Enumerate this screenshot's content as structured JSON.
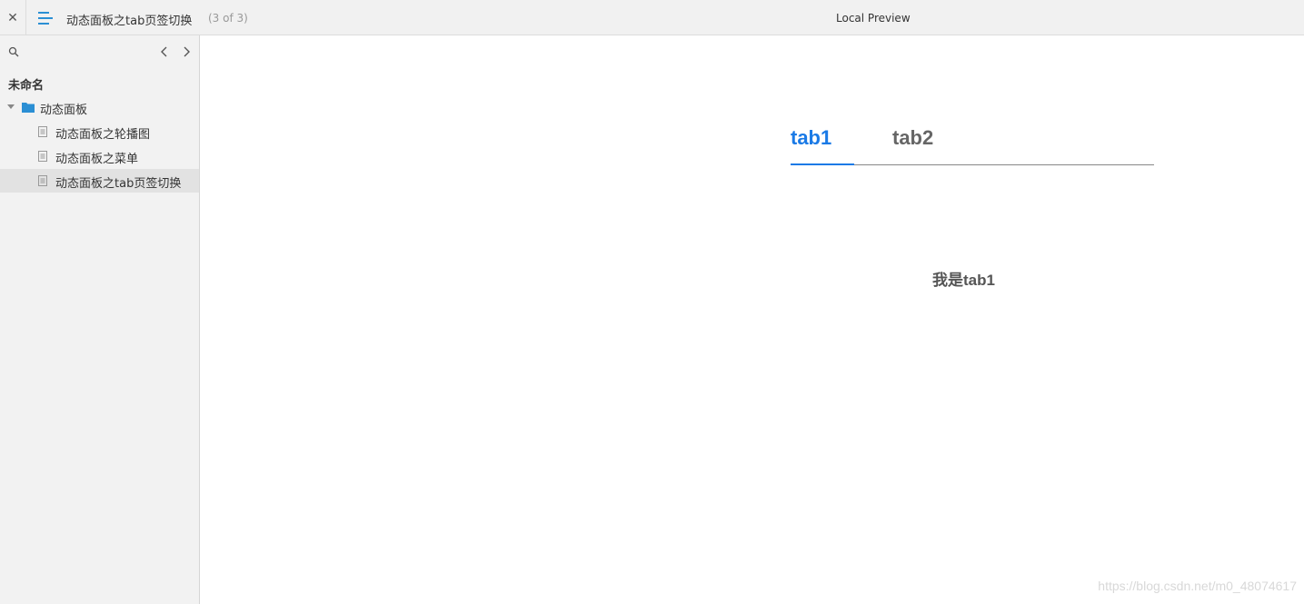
{
  "topbar": {
    "close_icon": "close-icon",
    "menu_icon": "menu-lines-icon",
    "doc_title": "动态面板之tab页签切换",
    "doc_count": "(3 of 3)",
    "preview_title": "Local Preview"
  },
  "sidebar": {
    "project_name": "未命名",
    "folder": {
      "label": "动态面板"
    },
    "pages": [
      {
        "label": "动态面板之轮播图"
      },
      {
        "label": "动态面板之菜单"
      },
      {
        "label": "动态面板之tab页签切换",
        "active": true
      }
    ]
  },
  "content": {
    "tabs": [
      {
        "label": "tab1",
        "active": true
      },
      {
        "label": "tab2",
        "active": false
      }
    ],
    "panel_text": "我是tab1"
  },
  "watermark": "https://blog.csdn.net/m0_48074617",
  "colors": {
    "accent": "#1a7ae6",
    "menu_icon": "#2b8fd4",
    "folder_icon": "#2b8fd4",
    "sidebar_bg": "#f2f2f2"
  }
}
